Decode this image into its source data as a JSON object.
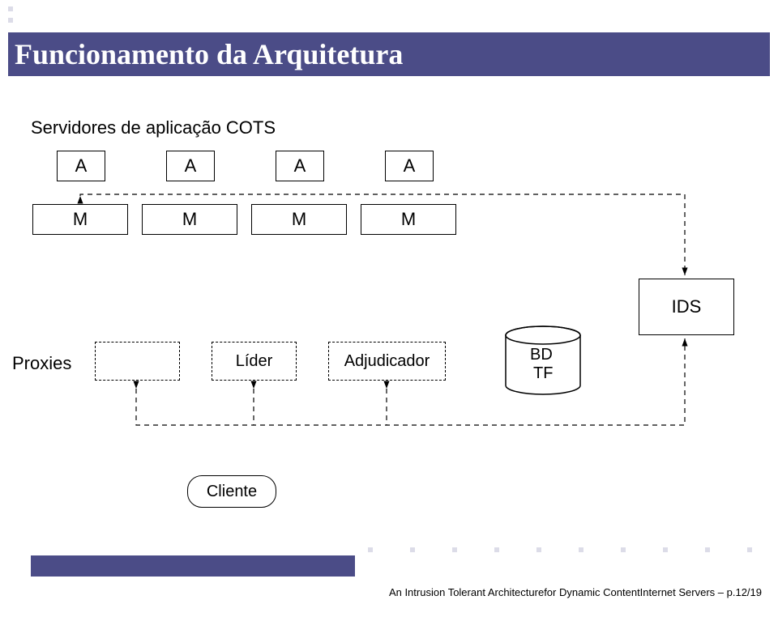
{
  "title": "Funcionamento da Arquitetura",
  "server_label": "Servidores de aplicação COTS",
  "a_boxes": [
    "A",
    "A",
    "A",
    "A"
  ],
  "m_boxes": [
    "M",
    "M",
    "M",
    "M"
  ],
  "ids_label": "IDS",
  "proxies_label": "Proxies",
  "lider_label": "Líder",
  "adjudicador_label": "Adjudicador",
  "bd_label": "BD",
  "tf_label": "TF",
  "cliente_label": "Cliente",
  "footer_text": "An Intrusion Tolerant Architecturefor Dynamic ContentInternet Servers – p.12/19"
}
